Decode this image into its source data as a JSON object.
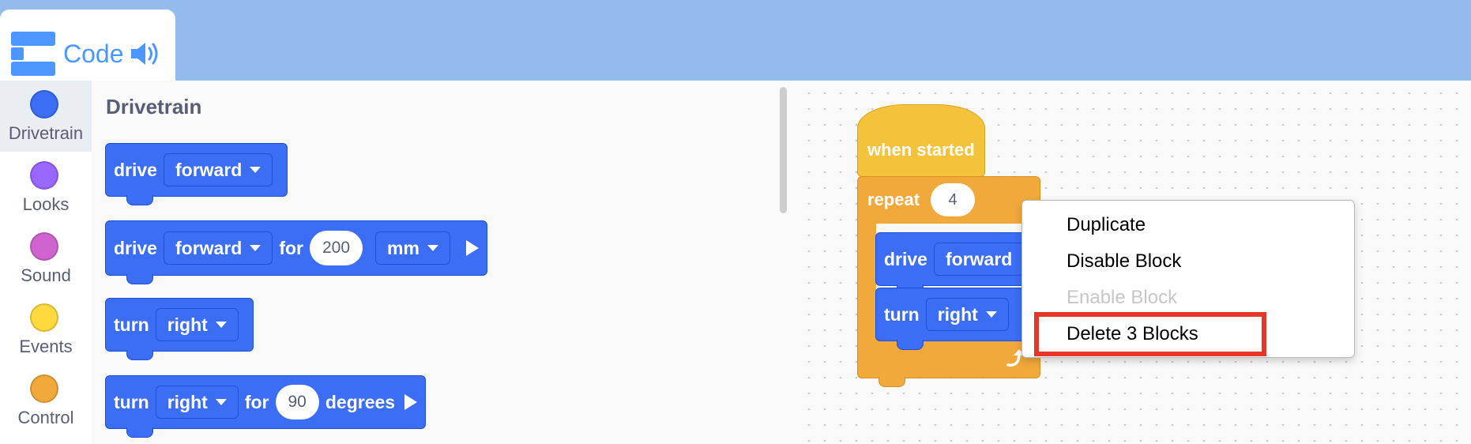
{
  "tab": {
    "label": "Code",
    "icon": "code-blocks-icon",
    "speaker_icon": "speaker-icon"
  },
  "categories": [
    {
      "label": "Drivetrain",
      "color": "#3b6ef5",
      "selected": true
    },
    {
      "label": "Looks",
      "color": "#9966ff"
    },
    {
      "label": "Sound",
      "color": "#cf63cf"
    },
    {
      "label": "Events",
      "color": "#ffd93d"
    },
    {
      "label": "Control",
      "color": "#f2a93b"
    }
  ],
  "flyout": {
    "title": "Drivetrain",
    "blocks": [
      {
        "verb": "drive",
        "direction": "forward"
      },
      {
        "verb": "drive",
        "direction": "forward",
        "for_label": "for",
        "amount": "200",
        "unit": "mm"
      },
      {
        "verb": "turn",
        "direction": "right"
      },
      {
        "verb": "turn",
        "direction": "right",
        "for_label": "for",
        "amount": "90",
        "unit": "degrees"
      }
    ]
  },
  "workspace": {
    "hat_label": "when started",
    "repeat_label": "repeat",
    "repeat_count": "4",
    "inner_blocks": [
      {
        "verb": "drive",
        "direction": "forward"
      },
      {
        "verb": "turn",
        "direction": "right"
      }
    ]
  },
  "context_menu": {
    "items": [
      {
        "label": "Duplicate",
        "enabled": true
      },
      {
        "label": "Disable Block",
        "enabled": true
      },
      {
        "label": "Enable Block",
        "enabled": false
      },
      {
        "label": "Delete 3 Blocks",
        "enabled": true,
        "highlighted": true
      }
    ]
  },
  "colors": {
    "topbar": "#93bcec",
    "accent": "#4c97ff",
    "motion_block": "#3b6ef5",
    "event_block": "#f5c33b",
    "control_block": "#f2a93b",
    "highlight": "#e4372a"
  }
}
